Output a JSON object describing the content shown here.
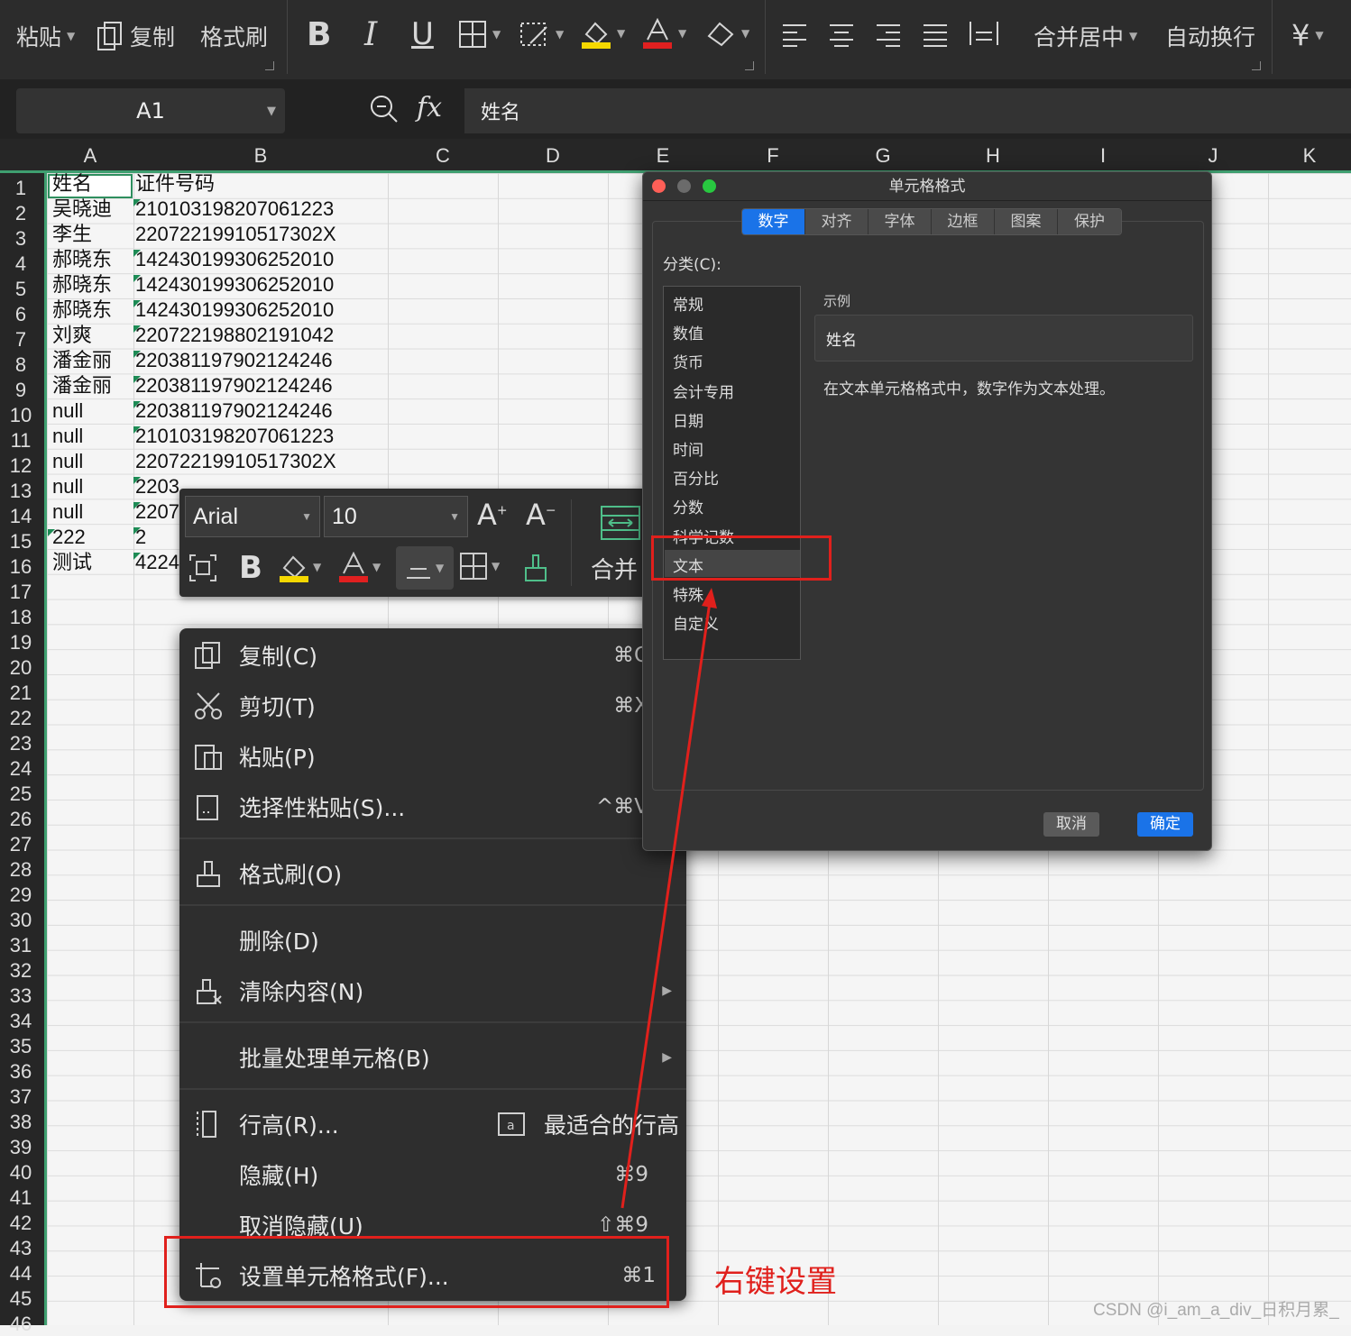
{
  "toolbar": {
    "paste": "粘贴",
    "copy": "复制",
    "format_painter": "格式刷",
    "merge_center": "合并居中",
    "wrap_text": "自动换行",
    "currency_symbol": "¥"
  },
  "formula_bar": {
    "cell_ref": "A1",
    "fx": "fx",
    "value": "姓名"
  },
  "columns": [
    "A",
    "B",
    "C",
    "D",
    "E",
    "F",
    "G",
    "H",
    "I",
    "J",
    "K"
  ],
  "rows": [
    "1",
    "2",
    "3",
    "4",
    "5",
    "6",
    "7",
    "8",
    "9",
    "10",
    "11",
    "12",
    "13",
    "14",
    "15",
    "16",
    "17",
    "18",
    "19",
    "20",
    "21",
    "22",
    "23",
    "24",
    "25",
    "26",
    "27",
    "28",
    "29",
    "30",
    "31",
    "32",
    "33",
    "34",
    "35",
    "36",
    "37",
    "38",
    "39",
    "40",
    "41",
    "42",
    "43",
    "44",
    "45",
    "46"
  ],
  "cells": {
    "a": [
      "姓名",
      "吴晓迪",
      "李生",
      "郝晓东",
      "郝晓东",
      "郝晓东",
      "刘爽",
      "潘金丽",
      "潘金丽",
      "null",
      "null",
      "null",
      "null",
      "null",
      "222",
      "测试"
    ],
    "b": [
      "证件号码",
      "210103198207061223",
      "22072219910517302X",
      "142430199306252010",
      "142430199306252010",
      "142430199306252010",
      "220722198802191042",
      "220381197902124246",
      "220381197902124246",
      "220381197902124246",
      "210103198207061223",
      "22072219910517302X",
      "2203",
      "2207",
      "2",
      "4224"
    ]
  },
  "mini_toolbar": {
    "font": "Arial",
    "size": "10",
    "merge": "合并"
  },
  "context_menu": {
    "copy": {
      "label": "复制(C)",
      "shortcut": "⌘C"
    },
    "cut": {
      "label": "剪切(T)",
      "shortcut": "⌘X"
    },
    "paste": {
      "label": "粘贴(P)",
      "shortcut": ""
    },
    "paste_special": {
      "label": "选择性粘贴(S)...",
      "shortcut": "^⌘V"
    },
    "format_painter": {
      "label": "格式刷(O)"
    },
    "delete": {
      "label": "删除(D)"
    },
    "clear": {
      "label": "清除内容(N)"
    },
    "batch": {
      "label": "批量处理单元格(B)"
    },
    "row_height": {
      "label": "行高(R)..."
    },
    "best_fit": {
      "label": "最适合的行高"
    },
    "hide": {
      "label": "隐藏(H)",
      "shortcut": "⌘9"
    },
    "unhide": {
      "label": "取消隐藏(U)",
      "shortcut": "⇧⌘9"
    },
    "format_cells": {
      "label": "设置单元格格式(F)...",
      "shortcut": "⌘1"
    }
  },
  "dialog": {
    "title": "单元格格式",
    "tabs": [
      "数字",
      "对齐",
      "字体",
      "边框",
      "图案",
      "保护"
    ],
    "category_label": "分类(C):",
    "categories": [
      "常规",
      "数值",
      "货币",
      "会计专用",
      "日期",
      "时间",
      "百分比",
      "分数",
      "科学记数",
      "文本",
      "特殊",
      "自定义"
    ],
    "selected_category": "文本",
    "sample_label": "示例",
    "sample_value": "姓名",
    "description": "在文本单元格格式中，数字作为文本处理。",
    "cancel": "取消",
    "ok": "确定"
  },
  "annotation": {
    "text": "右键设置",
    "color": "#e0201c"
  },
  "watermark": "CSDN @i_am_a_div_日积月累_",
  "colors": {
    "accent_green": "#3f9f70",
    "dialog_primary": "#1a73e8",
    "annotation_red": "#e0201c"
  }
}
